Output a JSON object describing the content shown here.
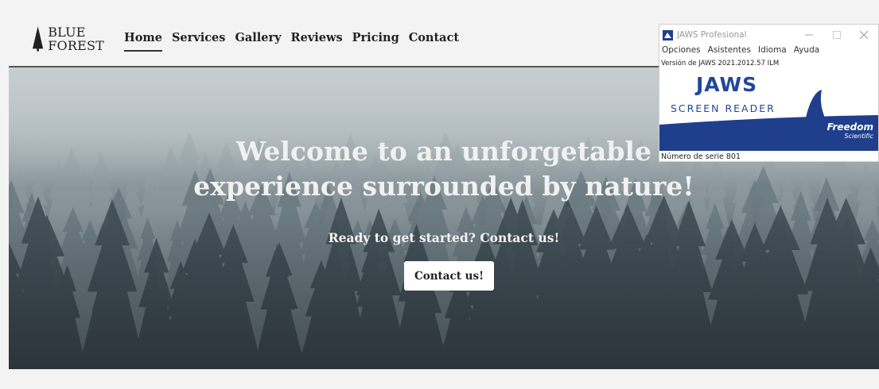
{
  "site": {
    "logo": {
      "line1": "BLUE",
      "line2": "FOREST"
    },
    "nav": [
      {
        "label": "Home",
        "active": true
      },
      {
        "label": "Services",
        "active": false
      },
      {
        "label": "Gallery",
        "active": false
      },
      {
        "label": "Reviews",
        "active": false
      },
      {
        "label": "Pricing",
        "active": false
      },
      {
        "label": "Contact",
        "active": false
      }
    ],
    "hero": {
      "title_line1": "Welcome to an unforgetable",
      "title_line2": "experience surrounded by nature!",
      "subtitle": "Ready to get started? Contact us!",
      "button_label": "Contact us!"
    }
  },
  "jaws_window": {
    "title": "JAWS Profesional",
    "menu": [
      "Opciones",
      "Asistentes",
      "Idioma",
      "Ayuda"
    ],
    "version": "Versión de JAWS 2021.2012.57 ILM",
    "logo": "JAWS",
    "logo_sub": "SCREEN READER",
    "brand_line1": "Freedom",
    "brand_line2": "Scientific",
    "serial": "Número de serie 801"
  },
  "colors": {
    "jaws_blue": "#21479a",
    "hero_text": "#f1f1f1",
    "page_bg": "#f3f3f3"
  }
}
